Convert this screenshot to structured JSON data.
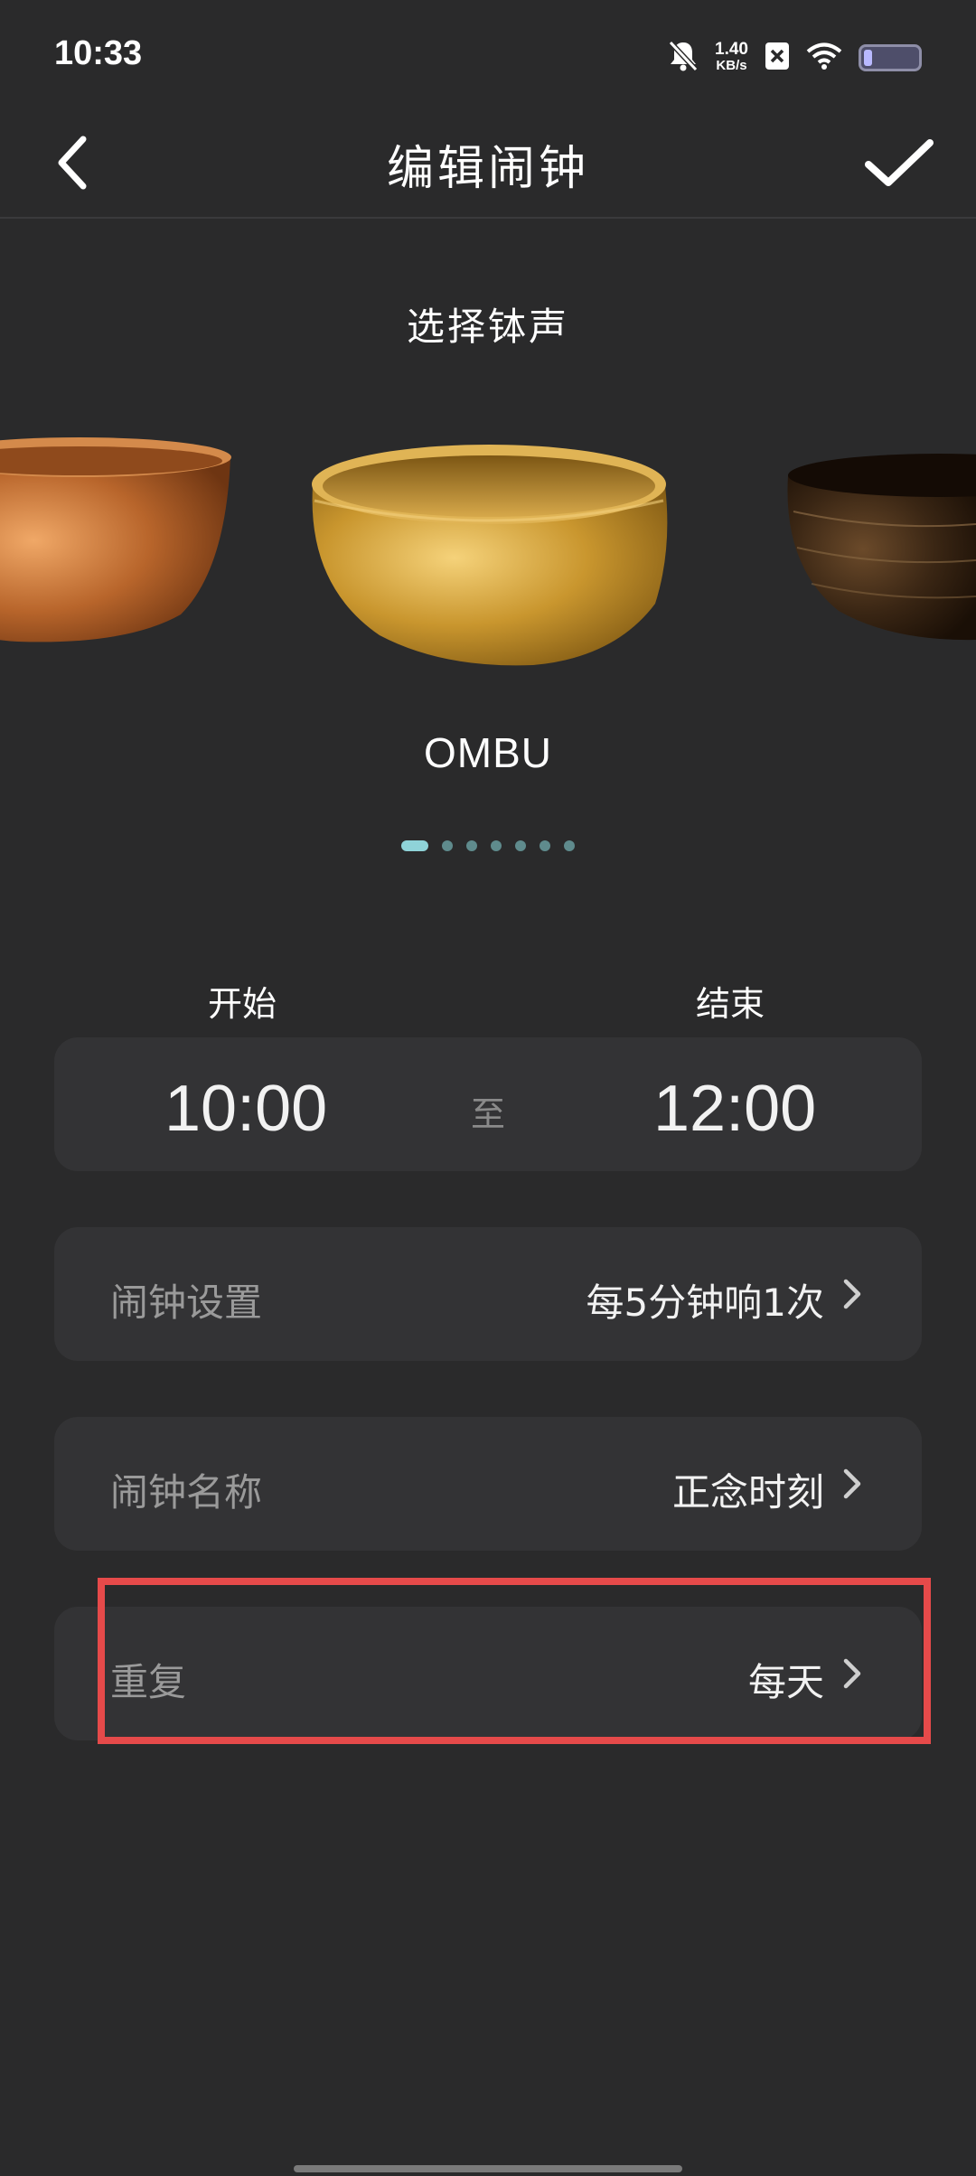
{
  "status_bar": {
    "time": "10:33",
    "net_speed_value": "1.40",
    "net_speed_unit": "KB/s",
    "icons": [
      "bell-off-icon",
      "close-box-icon",
      "wifi-icon",
      "battery-icon"
    ],
    "battery_level": 0.15
  },
  "header": {
    "title": "编辑闹钟",
    "back_icon": "chevron-left-icon",
    "confirm_icon": "check-icon"
  },
  "bowl_picker": {
    "title": "选择钵声",
    "selected_name": "OMBU",
    "page_count": 7,
    "active_page": 0
  },
  "time_range": {
    "start_label": "开始",
    "end_label": "结束",
    "start_time": "10:00",
    "separator": "至",
    "end_time": "12:00"
  },
  "rows": {
    "alarm_setting": {
      "label": "闹钟设置",
      "value": "每5分钟响1次"
    },
    "alarm_name": {
      "label": "闹钟名称",
      "value": "正念时刻"
    },
    "repeat": {
      "label": "重复",
      "value": "每天"
    }
  },
  "colors": {
    "background": "#2a2a2b",
    "card": "#333335",
    "accent_dot": "#8fd3d8",
    "highlight": "#e64a4a"
  }
}
